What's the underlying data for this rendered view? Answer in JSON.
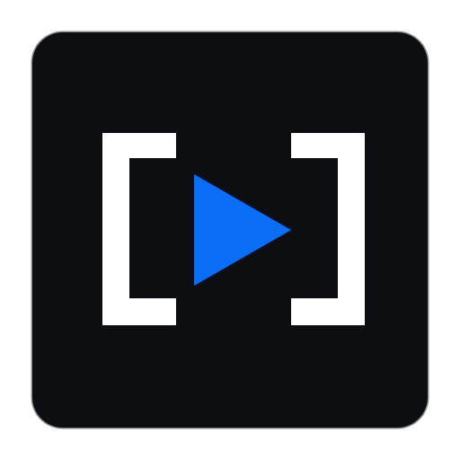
{
  "app_icon": {
    "name": "",
    "background_color": "#0d0e12",
    "border_color": "#8a8b8f",
    "glyphs": {
      "left_bracket": "bracket-left-icon",
      "right_bracket": "bracket-right-icon",
      "play": "play-icon"
    },
    "colors": {
      "brackets": "#ffffff",
      "play": "#0a6ef7"
    }
  }
}
